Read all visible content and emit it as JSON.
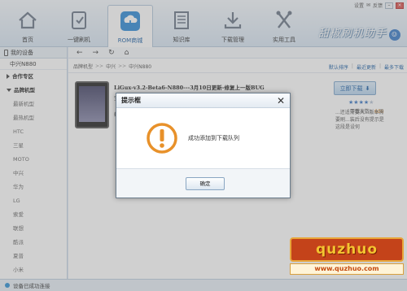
{
  "window": {
    "settings_label": "设置",
    "feedback_label": "反馈",
    "brand": "甜椒刷机助手"
  },
  "tabs": [
    {
      "label": "首页",
      "icon": "home-icon"
    },
    {
      "label": "一键刷机",
      "icon": "flash-icon"
    },
    {
      "label": "ROM商城",
      "icon": "cloud-download-icon"
    },
    {
      "label": "知识库",
      "icon": "document-icon"
    },
    {
      "label": "下载管理",
      "icon": "download-icon"
    },
    {
      "label": "实用工具",
      "icon": "tools-icon"
    }
  ],
  "active_tab": "ROM商城",
  "sidebar": {
    "my_device": "我的设备",
    "model": "中兴N880",
    "groups": [
      {
        "label": "合作专区",
        "expanded": false
      },
      {
        "label": "品牌机型",
        "expanded": true
      }
    ],
    "items": [
      "最新机型",
      "最热机型",
      "HTC",
      "三星",
      "MOTO",
      "中兴",
      "华为",
      "LG",
      "索爱",
      "联想",
      "酷派",
      "夏普",
      "小米"
    ]
  },
  "content": {
    "breadcrumb": [
      "品牌机型",
      "中兴",
      "中兴N880"
    ],
    "sort_options": [
      "默认排序",
      "最近更新",
      "最多下载"
    ],
    "rom": {
      "title": "LiGux-v3.2-Beta6-N880---3月10日更新-修复上一版BUG",
      "side_text_1": "宝",
      "side_text_2": "截",
      "desc": "...还适需要大...版本需要刷...装后没有提示是这段是设何",
      "download_label": "立即下载",
      "rating": 4,
      "rating_max": 5,
      "downloads_label": "下载次数：",
      "downloads_value": "600"
    }
  },
  "status": {
    "text": "设备已成功连接"
  },
  "dialog": {
    "title": "提示框",
    "message": "成功添加到下载队列",
    "ok_label": "确定"
  },
  "watermark": {
    "logo": "quzhuo",
    "url": "www.quzhuo.com"
  },
  "colors": {
    "accent": "#1b5fa5",
    "warning": "#e8912a",
    "download_count": "#e07b00"
  }
}
